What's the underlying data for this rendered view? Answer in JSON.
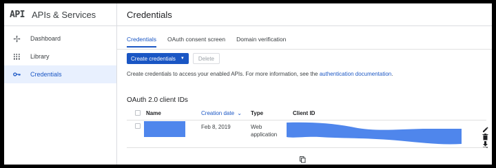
{
  "sidebar": {
    "logo": "API",
    "title": "APIs & Services",
    "items": [
      {
        "label": "Dashboard",
        "icon": "dashboard-icon"
      },
      {
        "label": "Library",
        "icon": "library-icon"
      },
      {
        "label": "Credentials",
        "icon": "key-icon",
        "active": true
      }
    ]
  },
  "main": {
    "title": "Credentials",
    "tabs": [
      {
        "label": "Credentials",
        "active": true
      },
      {
        "label": "OAuth consent screen"
      },
      {
        "label": "Domain verification"
      }
    ],
    "create_button": "Create credentials",
    "delete_button": "Delete",
    "info_text": "Create credentials to access your enabled APIs. For more information, see the ",
    "info_link": "authentication documentation",
    "info_end": ".",
    "section_title": "OAuth 2.0 client IDs",
    "table": {
      "headers": {
        "name": "Name",
        "creation_date": "Creation date",
        "type": "Type",
        "client_id": "Client ID"
      },
      "rows": [
        {
          "date": "Feb 8, 2019",
          "type_line1": "Web",
          "type_line2": "application"
        }
      ]
    }
  },
  "colors": {
    "accent": "#1a56c4",
    "redaction": "#4f86ec",
    "active_bg": "#e8f0fe"
  }
}
